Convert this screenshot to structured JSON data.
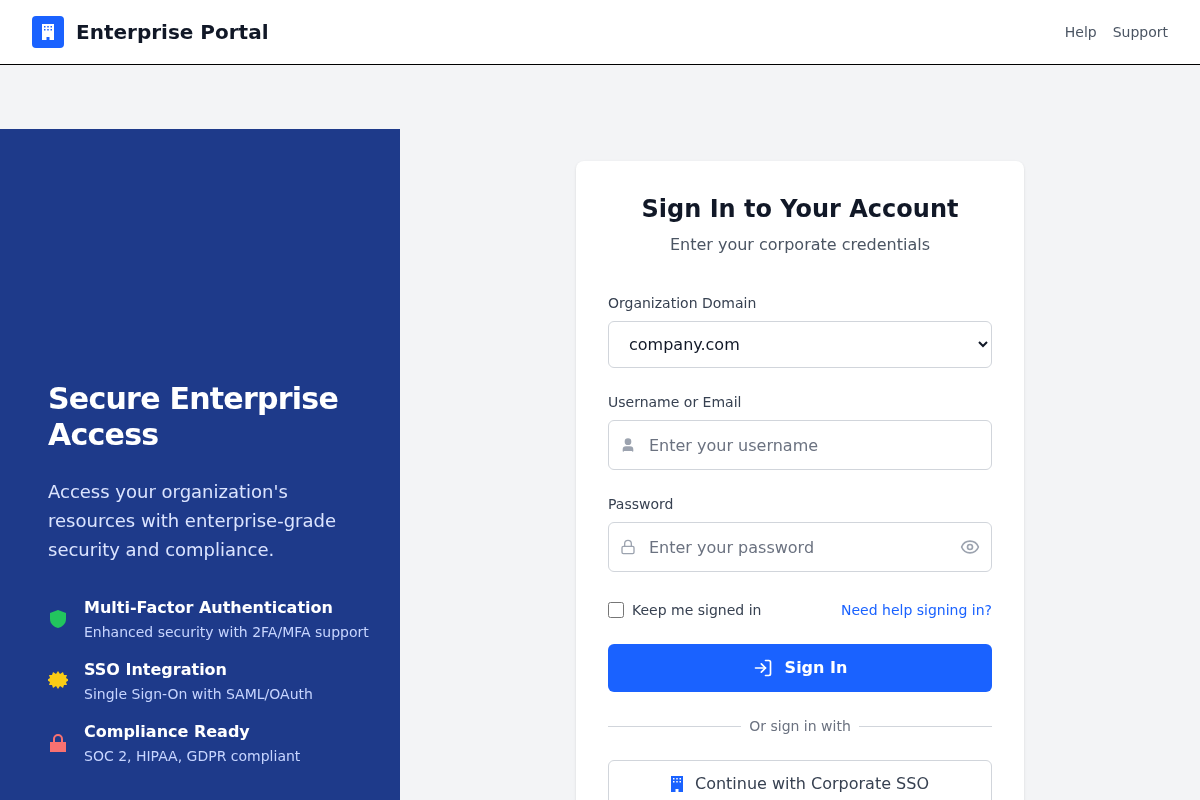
{
  "header": {
    "title": "Enterprise Portal",
    "links": [
      "Help",
      "Support"
    ]
  },
  "hero": {
    "title": "Secure Enterprise Access",
    "text": "Access your organization's resources with enterprise-grade security and compliance.",
    "features": [
      {
        "kind": "shield",
        "color": "#22c55e",
        "title": "Multi-Factor Authentication",
        "text": "Enhanced security with 2FA/MFA support"
      },
      {
        "kind": "badge",
        "color": "#facc15",
        "title": "SSO Integration",
        "text": "Single Sign-On with SAML/OAuth"
      },
      {
        "kind": "lock",
        "color": "#f87171",
        "title": "Compliance Ready",
        "text": "SOC 2, HIPAA, GDPR compliant"
      }
    ]
  },
  "card": {
    "title": "Sign In to Your Account",
    "subtitle": "Enter your corporate credentials",
    "domain": {
      "label": "Organization Domain",
      "value": "company.com"
    },
    "username": {
      "label": "Username or Email",
      "placeholder": "Enter your username"
    },
    "password": {
      "label": "Password",
      "placeholder": "Enter your password"
    },
    "remember": {
      "label": "Keep me signed in",
      "checked": false
    },
    "help_link": "Need help signing in?",
    "submit": "Sign In",
    "divider": "Or sign in with",
    "sso": "Continue with Corporate SSO"
  }
}
